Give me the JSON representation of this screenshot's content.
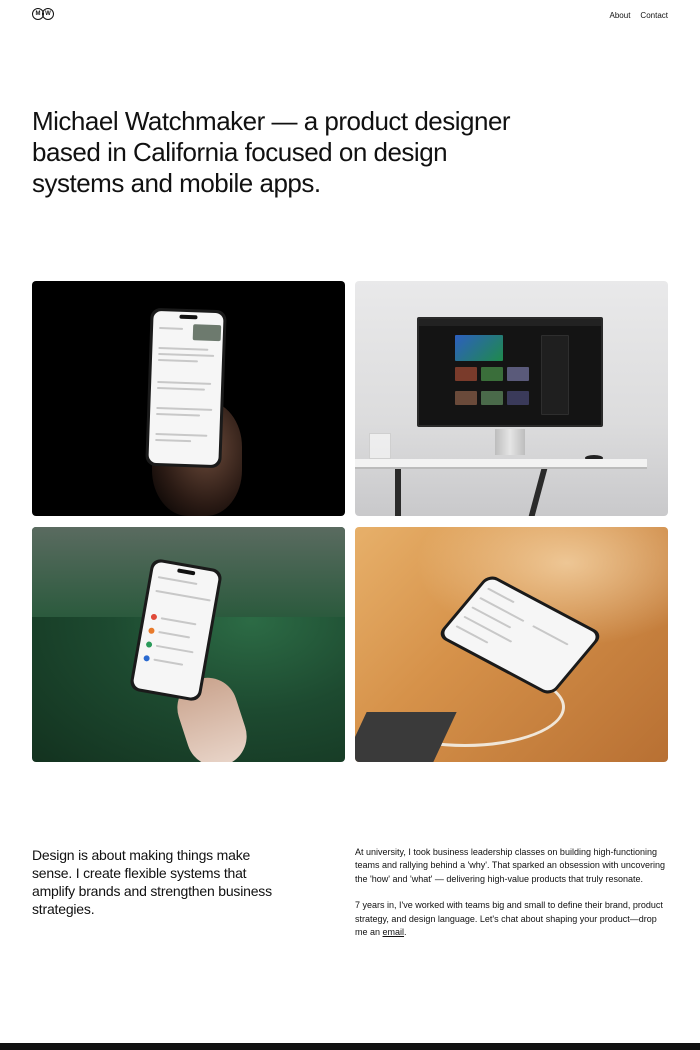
{
  "header": {
    "logo_letters": [
      "M",
      "W"
    ],
    "nav": [
      {
        "label": "About"
      },
      {
        "label": "Contact"
      }
    ]
  },
  "hero": {
    "headline": "Michael Watchmaker — a product designer based in California focused on design systems and mobile apps."
  },
  "gallery": {
    "tiles": [
      {
        "description": "phone-chat-app-dark"
      },
      {
        "description": "desktop-sports-dashboard"
      },
      {
        "description": "phone-payments-app-green"
      },
      {
        "description": "phone-detail-app-wood-desk"
      }
    ]
  },
  "about": {
    "intro": "Design is about making things make sense. I create flexible systems that amplify brands and strengthen business strategies.",
    "paragraph1": "At university, I took business leadership classes on building high-functioning teams and rallying behind a 'why'. That sparked an obsession with uncovering the 'how' and 'what' — delivering high-value products that truly resonate.",
    "paragraph2_prefix": "7 years in, I've worked with teams big and small to define their brand, product strategy, and design language. Let's chat about shaping your product—drop me an ",
    "email_link": "email",
    "paragraph2_suffix": "."
  },
  "colors": {
    "text": "#111111",
    "background": "#ffffff",
    "footer": "#111111"
  }
}
